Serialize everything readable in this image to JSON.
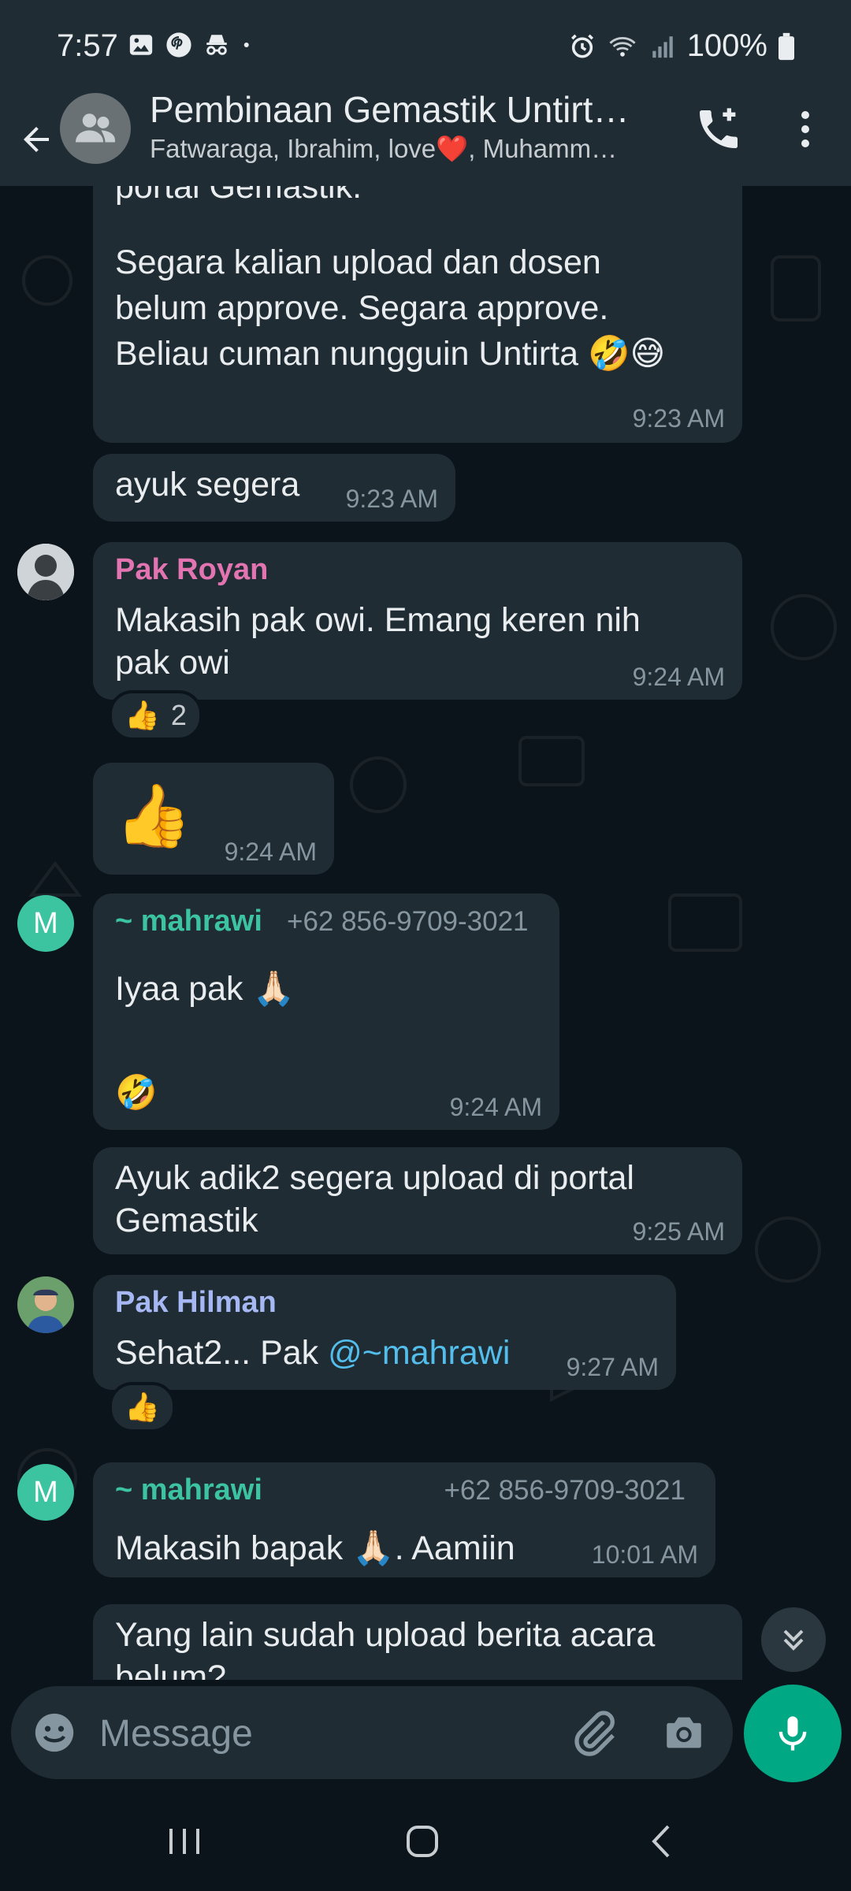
{
  "status_bar": {
    "time": "7:57",
    "battery": "100%"
  },
  "header": {
    "title": "Pembinaan Gemastik Untirt…",
    "subtitle": "Fatwaraga, Ibrahim, love❤️, Muhamm…"
  },
  "messages": [
    {
      "text": "portal Gemastik.",
      "time": ""
    },
    {
      "text": "Segara kalian upload dan dosen\nbelum approve. Segara approve.\nBeliau cuman nungguin Untirta 🤣😅",
      "time": "9:23 AM"
    },
    {
      "text": "ayuk segera",
      "time": "9:23 AM"
    },
    {
      "sender": "Pak Royan",
      "text": "Makasih pak owi. Emang keren nih\npak owi",
      "time": "9:24 AM",
      "reaction": {
        "emoji": "👍",
        "count": "2"
      }
    },
    {
      "text": "👍",
      "time": "9:24 AM"
    },
    {
      "sender": "~ mahrawi",
      "phone": "+62 856-9709-3021",
      "text": "Iyaa pak 🙏🏻\n\n🤣",
      "time": "9:24 AM",
      "avatar_letter": "M"
    },
    {
      "text": "Ayuk adik2 segera upload di portal\nGemastik",
      "time": "9:25 AM"
    },
    {
      "sender": "Pak Hilman",
      "text_prefix": "Sehat2... Pak ",
      "mention": "@~mahrawi",
      "time": "9:27 AM",
      "reaction": {
        "emoji": "👍"
      }
    },
    {
      "sender": "~ mahrawi",
      "phone": "+62 856-9709-3021",
      "text": "Makasih bapak 🙏🏻. Aamiin",
      "time": "10:01 AM",
      "avatar_letter": "M"
    },
    {
      "text": "Yang lain sudah upload berita acara\nbelum?",
      "time": ""
    }
  ],
  "input": {
    "placeholder": "Message"
  },
  "colors": {
    "pak_royan": "#e374b2",
    "mahrawi": "#3cc4a0",
    "pak_hilman": "#a6b8f3",
    "accent": "#00a884"
  },
  "icons": [
    "back-arrow-icon",
    "group-icon",
    "add-call-icon",
    "more-vert-icon",
    "emoji-icon",
    "attach-icon",
    "camera-icon",
    "mic-icon",
    "chevron-double-down-icon",
    "recents-icon",
    "home-icon",
    "back-icon"
  ]
}
